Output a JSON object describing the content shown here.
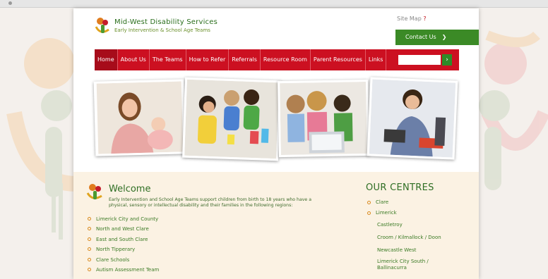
{
  "header": {
    "logo_title": "Mid-West Disability Services",
    "logo_subtitle": "Early Intervention & School Age Teams",
    "top_link_text": "Site Map",
    "top_link_accent": "?",
    "contact_label": "Contact Us",
    "contact_arrow": "❯"
  },
  "nav": {
    "items": [
      {
        "label": "Home",
        "active": true
      },
      {
        "label": "About Us",
        "active": false
      },
      {
        "label": "The Teams",
        "active": false
      },
      {
        "label": "How to Refer",
        "active": false
      },
      {
        "label": "Referrals",
        "active": false
      },
      {
        "label": "Resource Room",
        "active": false
      },
      {
        "label": "Parent Resources",
        "active": false
      },
      {
        "label": "Links",
        "active": false
      }
    ],
    "search_placeholder": "",
    "search_button": "›"
  },
  "welcome": {
    "title": "Welcome",
    "text": "Early Intervention and School Age Teams support children from birth to 18 years who have a physical, sensory or intellectual disability and their families in the following regions:",
    "links": [
      "Limerick City and County",
      "North and West Clare",
      "East and South Clare",
      "North Tipperary",
      "Clare Schools",
      "Autism Assessment Team"
    ]
  },
  "centres": {
    "title": "OUR CENTRES",
    "items": [
      {
        "label": "Clare",
        "level": "top"
      },
      {
        "label": "Limerick",
        "level": "top"
      },
      {
        "label": "Castletroy",
        "level": "sub"
      },
      {
        "label": "Croom / Kilmallock / Doon",
        "level": "sub"
      },
      {
        "label": "Newcastle West",
        "level": "sub"
      },
      {
        "label": "Limerick City South / Ballinacurra",
        "level": "wrap"
      }
    ]
  },
  "colors": {
    "brand_red": "#cc1021",
    "brand_green": "#3b8a26",
    "accent_orange": "#d98a1e",
    "band_cream": "#fbf2e3"
  }
}
